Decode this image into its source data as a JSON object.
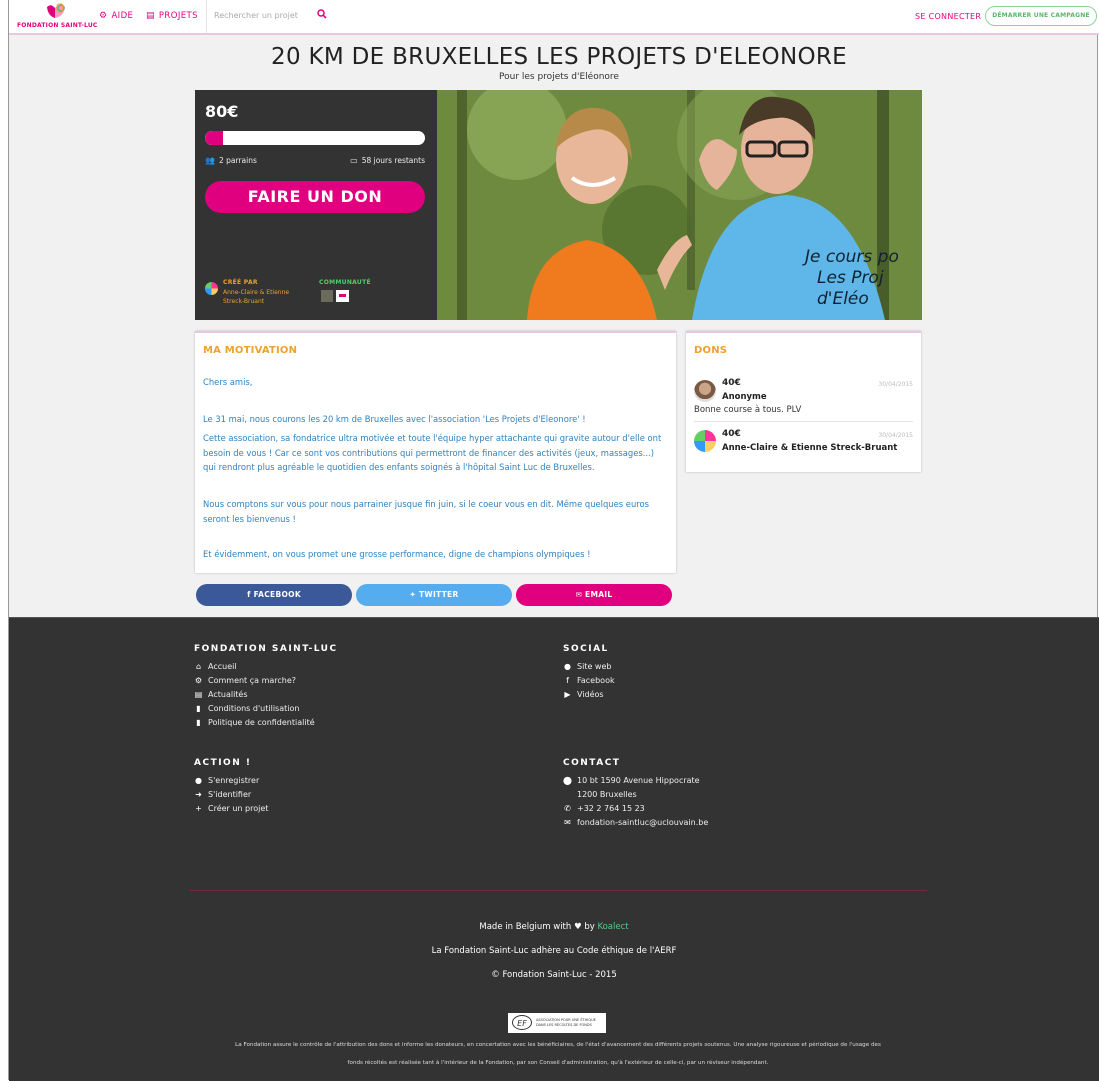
{
  "nav": {
    "logo_text": "FONDATION SAINT-LUC",
    "aide": "AIDE",
    "projets": "PROJETS",
    "search_placeholder": "Rechercher un projet",
    "login": "SE CONNECTER",
    "start_campaign": "DÉMARRER UNE CAMPAGNE"
  },
  "project": {
    "title": "20 KM DE BRUXELLES LES PROJETS D'ELEONORE",
    "subtitle": "Pour les projets d'Eléonore",
    "amount": "80€",
    "progress_fraction": 0.08,
    "sponsors": "2 parrains",
    "days_left": "58 jours restants",
    "donate_button": "FAIRE UN DON",
    "created_by_label": "CRÉÉ PAR",
    "creator_name": "Anne-Claire & Etienne Streck-Bruant",
    "community_label": "COMMUNAUTÉ",
    "photo_shirt_text_1": "Je cours po",
    "photo_shirt_text_2": "Les Proj",
    "photo_shirt_text_3": "d'Eléo"
  },
  "motivation": {
    "heading": "MA MOTIVATION",
    "p1": "Chers amis,",
    "p2": "Le 31 mai, nous courons les 20 km de Bruxelles avec l'association 'Les Projets d'Eleonore' !",
    "p3": "Cette association, sa fondatrice ultra motivée et toute l'équipe hyper attachante qui gravite autour d'elle ont besoin de vous ! Car ce sont vos contributions qui permettront de financer des activités (jeux, massages...) qui rendront plus agréable le quotidien des enfants soignés à l'hôpital Saint Luc de Bruxelles.",
    "p4": "Nous comptons sur vous pour nous parrainer jusque fin juin, si le coeur vous en dit. Même quelques euros seront les bienvenus !",
    "p5": "Et évidemment, on vous promet une grosse performance, digne de champions olympiques !"
  },
  "dons": {
    "heading": "DONS",
    "items": [
      {
        "amount": "40€",
        "date": "30/04/2015",
        "name": "Anonyme",
        "message": "Bonne course à tous. PLV"
      },
      {
        "amount": "40€",
        "date": "30/04/2015",
        "name": "Anne-Claire & Etienne Streck-Bruant",
        "message": ""
      }
    ]
  },
  "share": {
    "facebook": "FACEBOOK",
    "twitter": "TWITTER",
    "email": "EMAIL",
    "colors": {
      "facebook": "#3b5998",
      "twitter": "#55acee",
      "email": "#e0007f"
    }
  },
  "footer": {
    "col1_heading": "FONDATION SAINT-LUC",
    "col1_links": [
      "Accueil",
      "Comment ça marche?",
      "Actualités",
      "Conditions d'utilisation",
      "Politique de confidentialité"
    ],
    "col2_heading": "SOCIAL",
    "col2_links": [
      "Site web",
      "Facebook",
      "Vidéos"
    ],
    "col3_heading": "ACTION !",
    "col3_links": [
      "S'enregistrer",
      "S'identifier",
      "Créer un projet"
    ],
    "col4_heading": "CONTACT",
    "contact_address_1": "10 bt 1590 Avenue Hippocrate",
    "contact_address_2": "1200 Bruxelles",
    "contact_phone": "+32 2 764 15 23",
    "contact_email": "fondation-saintluc@uclouvain.be",
    "made_in_prefix": "Made in Belgium with",
    "made_in_by": "by",
    "koalect": "Koalect",
    "aerf_line": "La Fondation Saint-Luc adhère au Code éthique de l'AERF",
    "copyright": "© Fondation Saint-Luc - 2015",
    "aerf_badge_ef": "EF",
    "aerf_badge_text": "ASSOCIATION POUR UNE ÉTHIQUE DANS LES RÉCOLTES DE FONDS",
    "disclaimer_1": "La Fondation assure le contrôle de l'attribution des dons et informe les donateurs, en concertation avec les bénéficiaires, de l'état d'avancement des différents projets soutenus. Une analyse rigoureuse et périodique de l'usage des",
    "disclaimer_2": "fonds récoltés est réalisée tant à l'intérieur de la Fondation, par son Conseil d'administration, qu'à l'extérieur de celle-ci, par un réviseur indépendant."
  },
  "colors": {
    "brand": "#e0007f",
    "accent_orange": "#f0a030",
    "link_blue": "#2d83c4",
    "green": "#5ab66a",
    "footer_bg": "#333333"
  }
}
